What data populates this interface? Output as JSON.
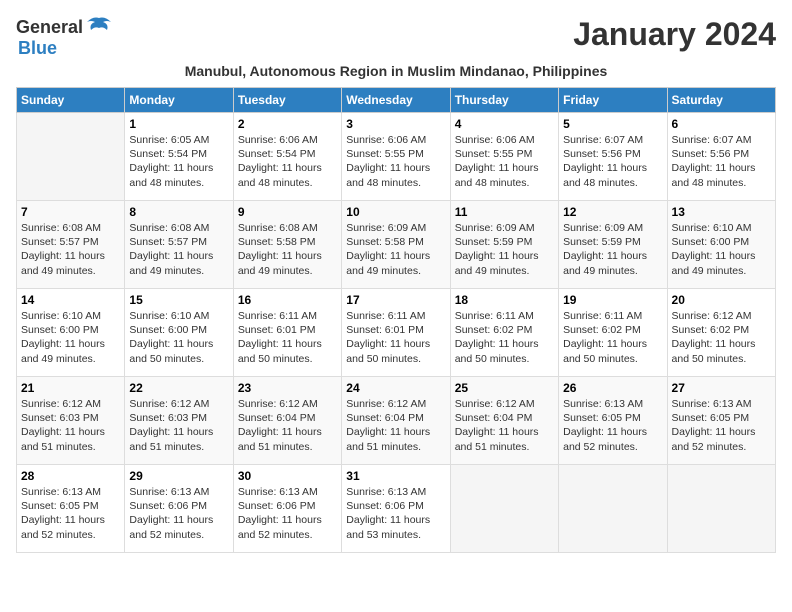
{
  "header": {
    "logo_general": "General",
    "logo_blue": "Blue",
    "month_title": "January 2024",
    "subtitle": "Manubul, Autonomous Region in Muslim Mindanao, Philippines"
  },
  "days_of_week": [
    "Sunday",
    "Monday",
    "Tuesday",
    "Wednesday",
    "Thursday",
    "Friday",
    "Saturday"
  ],
  "weeks": [
    [
      {
        "day": "",
        "info": ""
      },
      {
        "day": "1",
        "info": "Sunrise: 6:05 AM\nSunset: 5:54 PM\nDaylight: 11 hours and 48 minutes."
      },
      {
        "day": "2",
        "info": "Sunrise: 6:06 AM\nSunset: 5:54 PM\nDaylight: 11 hours and 48 minutes."
      },
      {
        "day": "3",
        "info": "Sunrise: 6:06 AM\nSunset: 5:55 PM\nDaylight: 11 hours and 48 minutes."
      },
      {
        "day": "4",
        "info": "Sunrise: 6:06 AM\nSunset: 5:55 PM\nDaylight: 11 hours and 48 minutes."
      },
      {
        "day": "5",
        "info": "Sunrise: 6:07 AM\nSunset: 5:56 PM\nDaylight: 11 hours and 48 minutes."
      },
      {
        "day": "6",
        "info": "Sunrise: 6:07 AM\nSunset: 5:56 PM\nDaylight: 11 hours and 48 minutes."
      }
    ],
    [
      {
        "day": "7",
        "info": "Sunrise: 6:08 AM\nSunset: 5:57 PM\nDaylight: 11 hours and 49 minutes."
      },
      {
        "day": "8",
        "info": "Sunrise: 6:08 AM\nSunset: 5:57 PM\nDaylight: 11 hours and 49 minutes."
      },
      {
        "day": "9",
        "info": "Sunrise: 6:08 AM\nSunset: 5:58 PM\nDaylight: 11 hours and 49 minutes."
      },
      {
        "day": "10",
        "info": "Sunrise: 6:09 AM\nSunset: 5:58 PM\nDaylight: 11 hours and 49 minutes."
      },
      {
        "day": "11",
        "info": "Sunrise: 6:09 AM\nSunset: 5:59 PM\nDaylight: 11 hours and 49 minutes."
      },
      {
        "day": "12",
        "info": "Sunrise: 6:09 AM\nSunset: 5:59 PM\nDaylight: 11 hours and 49 minutes."
      },
      {
        "day": "13",
        "info": "Sunrise: 6:10 AM\nSunset: 6:00 PM\nDaylight: 11 hours and 49 minutes."
      }
    ],
    [
      {
        "day": "14",
        "info": "Sunrise: 6:10 AM\nSunset: 6:00 PM\nDaylight: 11 hours and 49 minutes."
      },
      {
        "day": "15",
        "info": "Sunrise: 6:10 AM\nSunset: 6:00 PM\nDaylight: 11 hours and 50 minutes."
      },
      {
        "day": "16",
        "info": "Sunrise: 6:11 AM\nSunset: 6:01 PM\nDaylight: 11 hours and 50 minutes."
      },
      {
        "day": "17",
        "info": "Sunrise: 6:11 AM\nSunset: 6:01 PM\nDaylight: 11 hours and 50 minutes."
      },
      {
        "day": "18",
        "info": "Sunrise: 6:11 AM\nSunset: 6:02 PM\nDaylight: 11 hours and 50 minutes."
      },
      {
        "day": "19",
        "info": "Sunrise: 6:11 AM\nSunset: 6:02 PM\nDaylight: 11 hours and 50 minutes."
      },
      {
        "day": "20",
        "info": "Sunrise: 6:12 AM\nSunset: 6:02 PM\nDaylight: 11 hours and 50 minutes."
      }
    ],
    [
      {
        "day": "21",
        "info": "Sunrise: 6:12 AM\nSunset: 6:03 PM\nDaylight: 11 hours and 51 minutes."
      },
      {
        "day": "22",
        "info": "Sunrise: 6:12 AM\nSunset: 6:03 PM\nDaylight: 11 hours and 51 minutes."
      },
      {
        "day": "23",
        "info": "Sunrise: 6:12 AM\nSunset: 6:04 PM\nDaylight: 11 hours and 51 minutes."
      },
      {
        "day": "24",
        "info": "Sunrise: 6:12 AM\nSunset: 6:04 PM\nDaylight: 11 hours and 51 minutes."
      },
      {
        "day": "25",
        "info": "Sunrise: 6:12 AM\nSunset: 6:04 PM\nDaylight: 11 hours and 51 minutes."
      },
      {
        "day": "26",
        "info": "Sunrise: 6:13 AM\nSunset: 6:05 PM\nDaylight: 11 hours and 52 minutes."
      },
      {
        "day": "27",
        "info": "Sunrise: 6:13 AM\nSunset: 6:05 PM\nDaylight: 11 hours and 52 minutes."
      }
    ],
    [
      {
        "day": "28",
        "info": "Sunrise: 6:13 AM\nSunset: 6:05 PM\nDaylight: 11 hours and 52 minutes."
      },
      {
        "day": "29",
        "info": "Sunrise: 6:13 AM\nSunset: 6:06 PM\nDaylight: 11 hours and 52 minutes."
      },
      {
        "day": "30",
        "info": "Sunrise: 6:13 AM\nSunset: 6:06 PM\nDaylight: 11 hours and 52 minutes."
      },
      {
        "day": "31",
        "info": "Sunrise: 6:13 AM\nSunset: 6:06 PM\nDaylight: 11 hours and 53 minutes."
      },
      {
        "day": "",
        "info": ""
      },
      {
        "day": "",
        "info": ""
      },
      {
        "day": "",
        "info": ""
      }
    ]
  ]
}
